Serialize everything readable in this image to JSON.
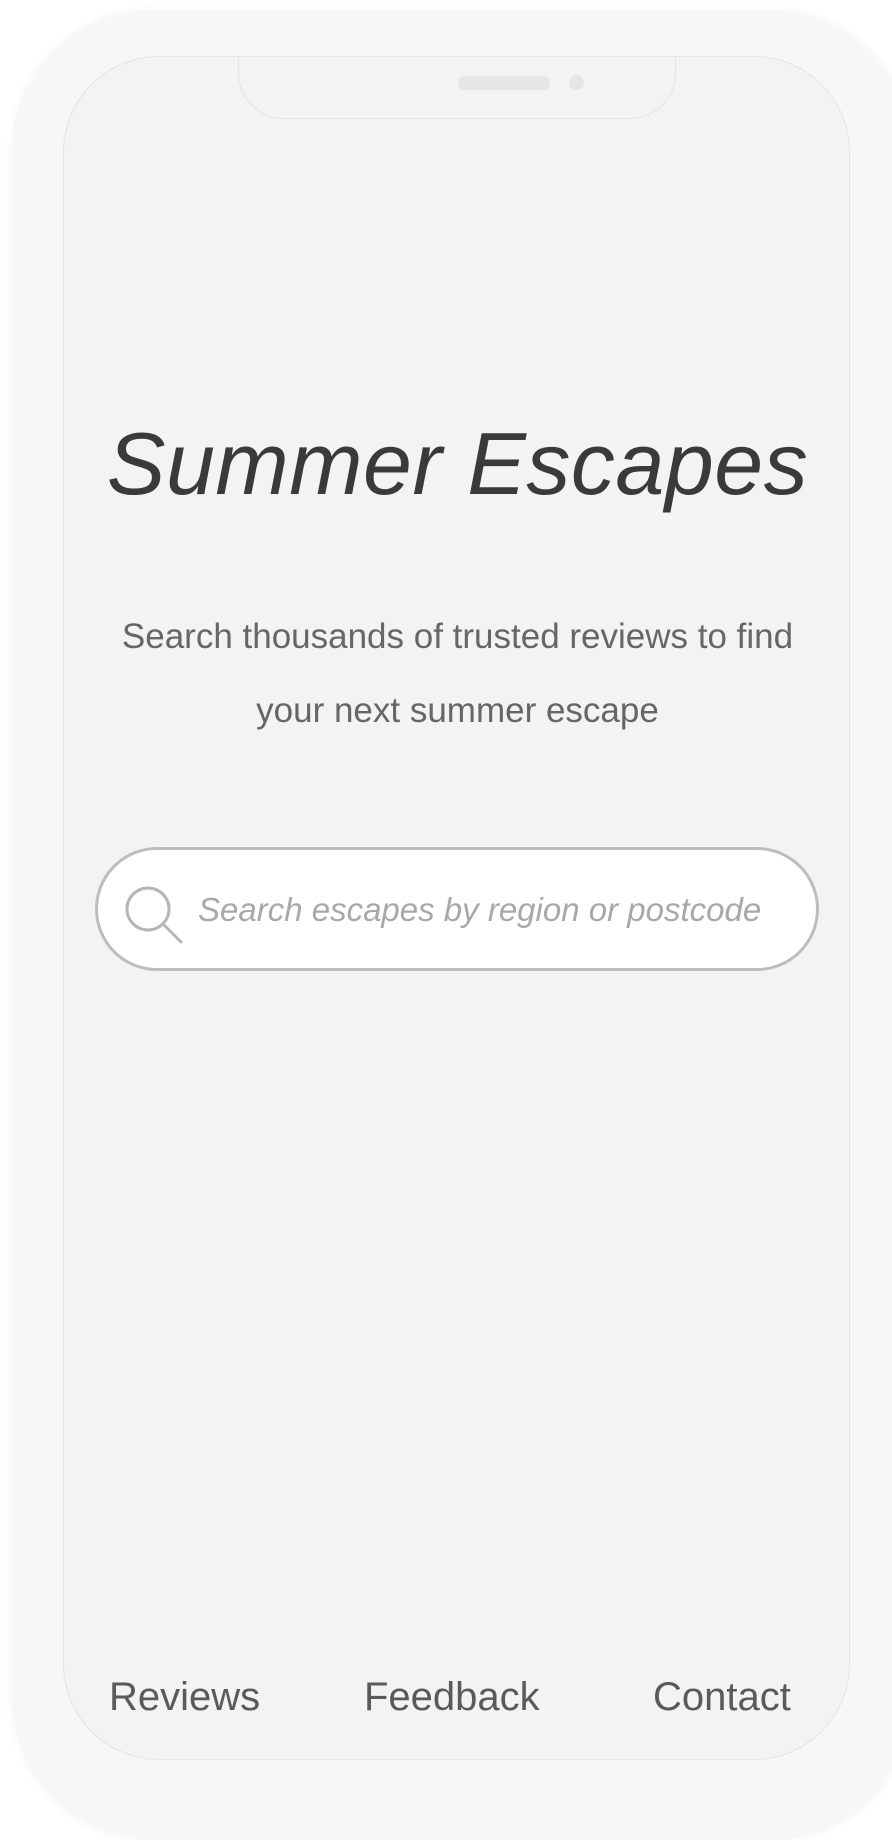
{
  "hero": {
    "title": "Summer Escapes",
    "subtitle": "Search thousands of trusted reviews to find your next summer escape"
  },
  "search": {
    "placeholder": "Search escapes by region or postcode",
    "value": "",
    "icon": "search-icon"
  },
  "footer": {
    "items": [
      {
        "label": "Reviews"
      },
      {
        "label": "Feedback"
      },
      {
        "label": "Contact"
      }
    ]
  },
  "colors": {
    "screen_background": "#f3f3f3",
    "frame": "#f6f7f7",
    "title_text": "#3a3a3a",
    "body_text": "#666666",
    "search_border": "#bdbdbd",
    "placeholder_text": "#a8a8a8"
  }
}
